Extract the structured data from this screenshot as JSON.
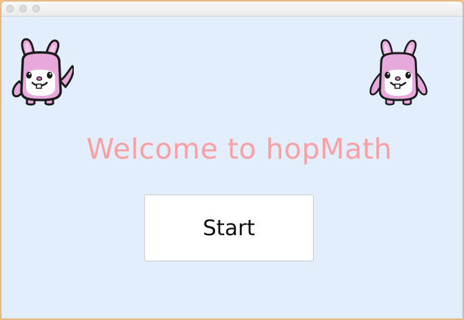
{
  "window": {
    "traffic_lights": [
      "close",
      "minimize",
      "zoom"
    ]
  },
  "main": {
    "title": "Welcome to hopMath",
    "start_button_label": "Start",
    "mascot_icon": "bunny-icon"
  },
  "colors": {
    "background": "#e3eefc",
    "title": "#f8a0a3",
    "bunny_fill": "#e7a9dc",
    "outline": "#1b1b1b"
  }
}
